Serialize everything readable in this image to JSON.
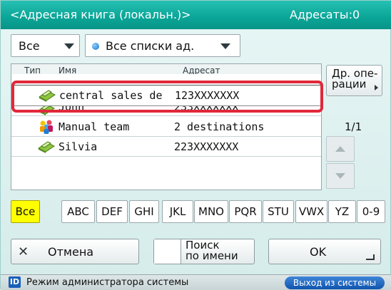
{
  "header": {
    "title": "<Адресная книга (локальн.)>",
    "recipients": "Адресаты:0"
  },
  "filters": {
    "type_value": "Все",
    "list_value": "Все списки ад."
  },
  "list": {
    "columns": {
      "type": "Тип",
      "name": "Имя",
      "address": "Адресат"
    },
    "rows": [
      {
        "icon": "fax-icon",
        "name": "central sales de",
        "address": "123XXXXXXX"
      },
      {
        "icon": "fax-icon",
        "name": "John",
        "address": "233XXXXXXX"
      },
      {
        "icon": "group-icon",
        "name": "Manual team",
        "address": "2 destinations"
      },
      {
        "icon": "fax-icon",
        "name": "Silvia",
        "address": "223XXXXXXX"
      }
    ]
  },
  "side": {
    "other_ops_line1": "Др. опе-",
    "other_ops_line2": "рации",
    "page": "1/1"
  },
  "letters": [
    "Все",
    "ABC",
    "DEF",
    "GHI",
    "JKL",
    "MNO",
    "PQR",
    "STU",
    "VWX",
    "YZ",
    "0-9"
  ],
  "buttons": {
    "cancel": "Отмена",
    "search_line1": "Поиск",
    "search_line2": "по имени",
    "ok": "OK"
  },
  "footer": {
    "id_badge": "ID",
    "admin_mode": "Режим администратора системы",
    "logout": "Выход из системы"
  },
  "colors": {
    "header": "#0aa597",
    "highlight": "#e0283a",
    "active_letter": "#ffff00",
    "logout": "#1a5fb8"
  }
}
